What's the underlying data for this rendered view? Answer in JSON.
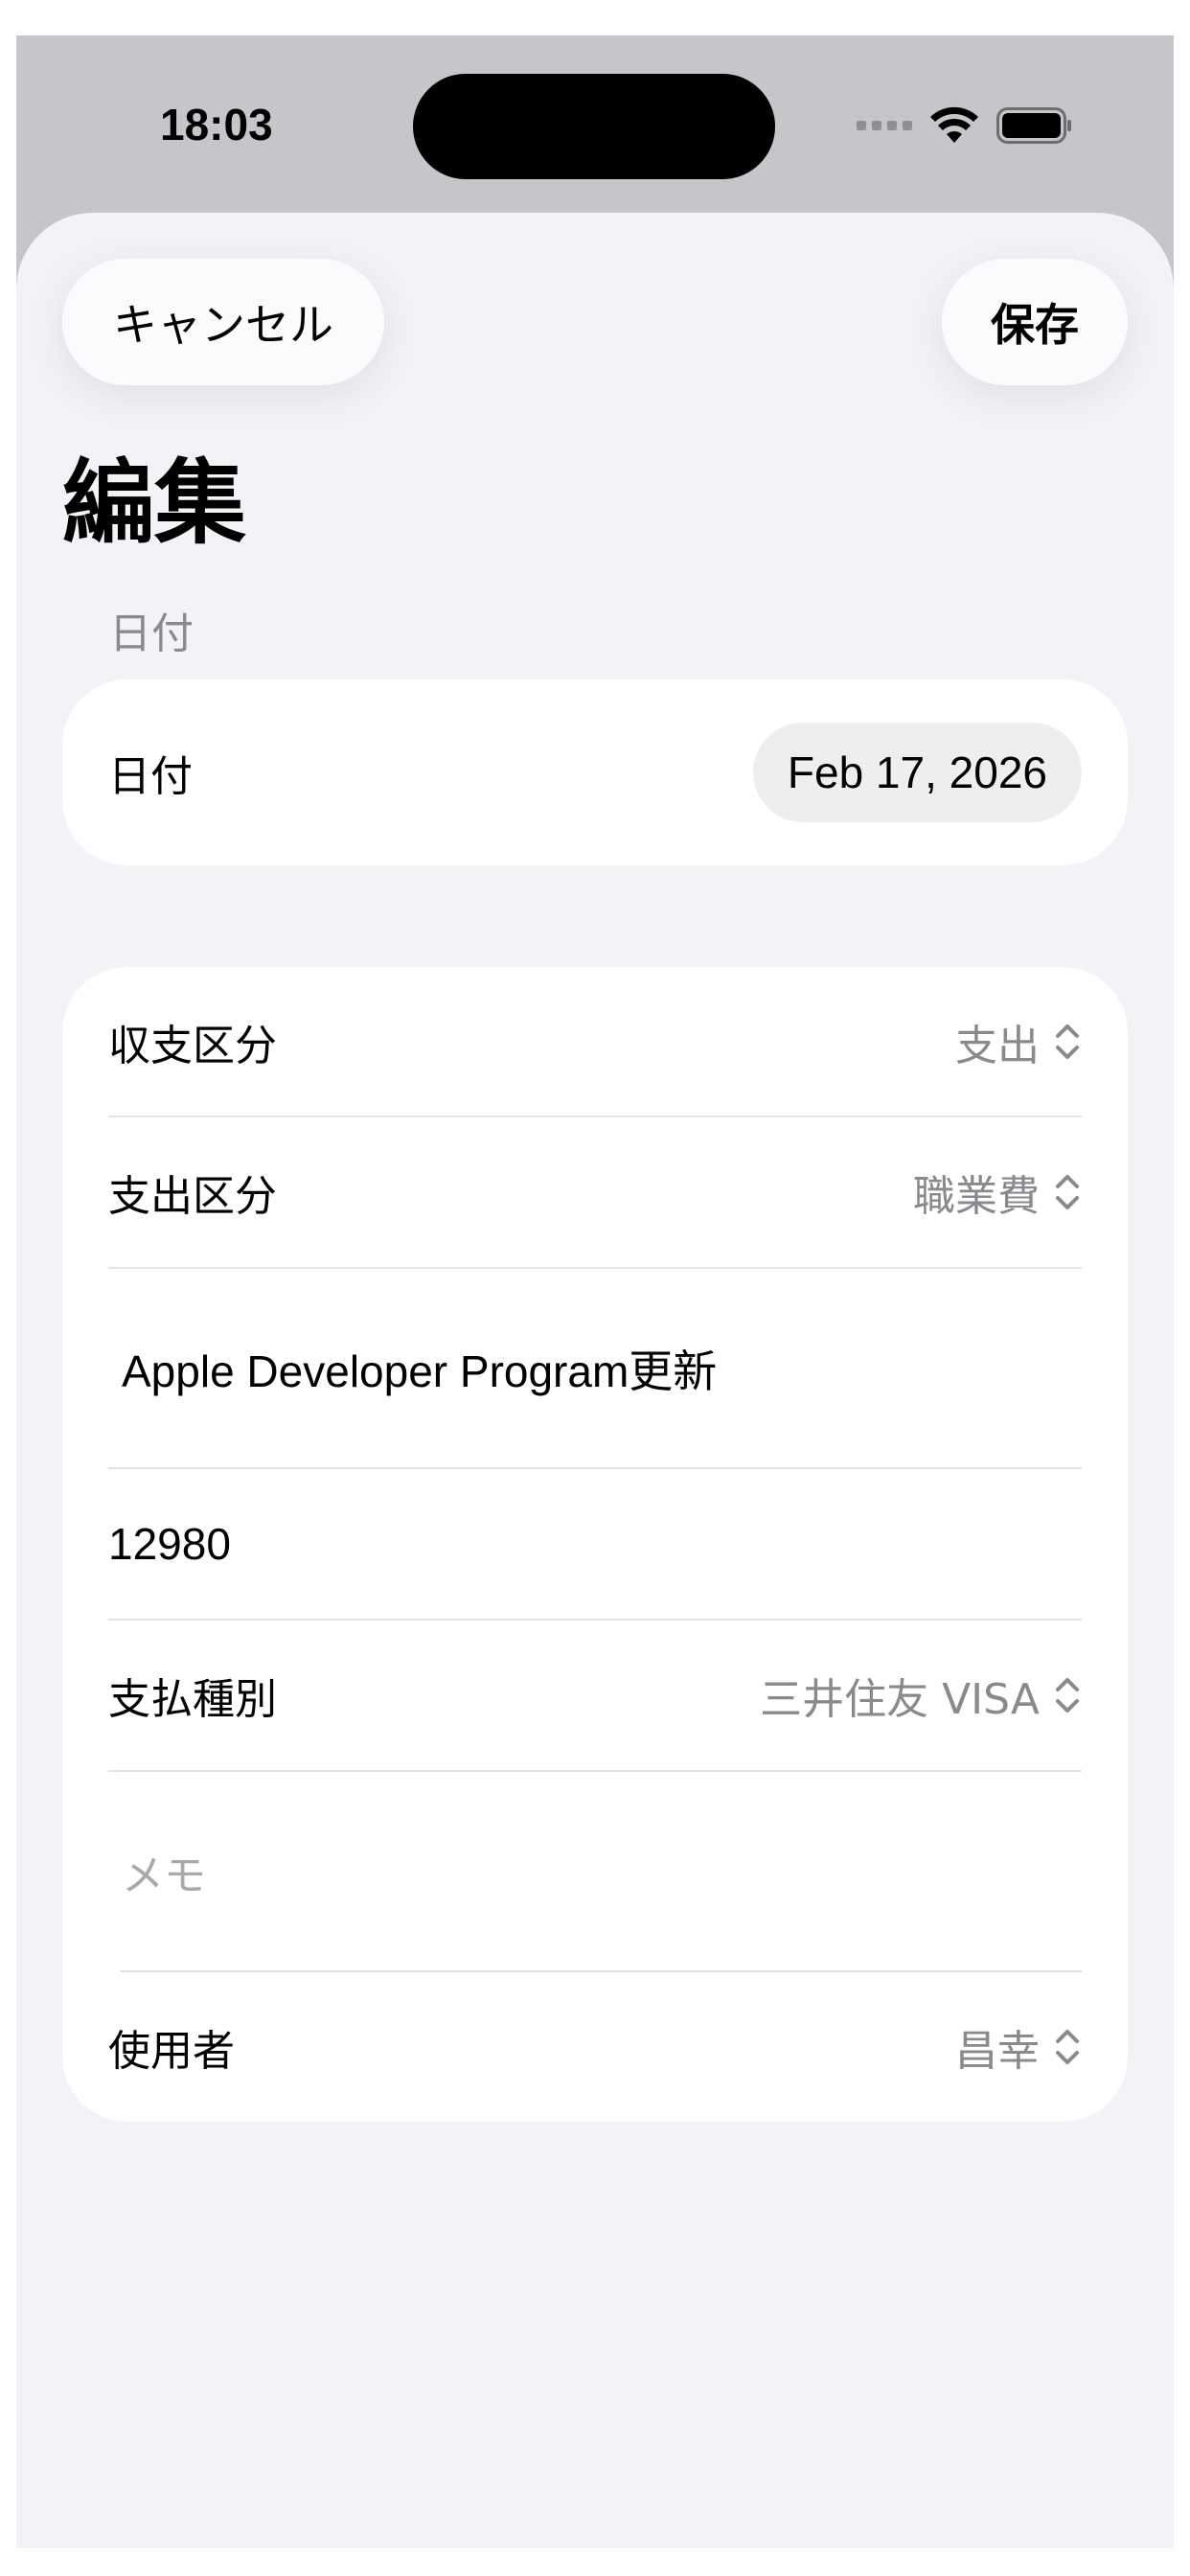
{
  "status_bar": {
    "time": "18:03",
    "icons": [
      "signal-dots-icon",
      "wifi-icon",
      "battery-icon"
    ]
  },
  "toolbar": {
    "cancel_label": "キャンセル",
    "save_label": "保存"
  },
  "nav": {
    "title": "編集"
  },
  "date_section": {
    "header": "日付",
    "row_label": "日付",
    "value": "Feb 17, 2026"
  },
  "form": {
    "income_type": {
      "label": "収支区分",
      "value": "支出"
    },
    "expense_type": {
      "label": "支出区分",
      "value": "職業費"
    },
    "title_value": "Apple Developer Program更新",
    "amount_value": "12980",
    "payment_type": {
      "label": "支払種別",
      "value": "三井住友 VISA"
    },
    "memo_placeholder": "メモ",
    "user": {
      "label": "使用者",
      "value": "昌幸"
    }
  },
  "colors": {
    "sheet_background": "#f2f2f7",
    "card_background": "#ffffff",
    "secondary_text": "#8a8a8e",
    "date_pill": "#eeeeef"
  }
}
